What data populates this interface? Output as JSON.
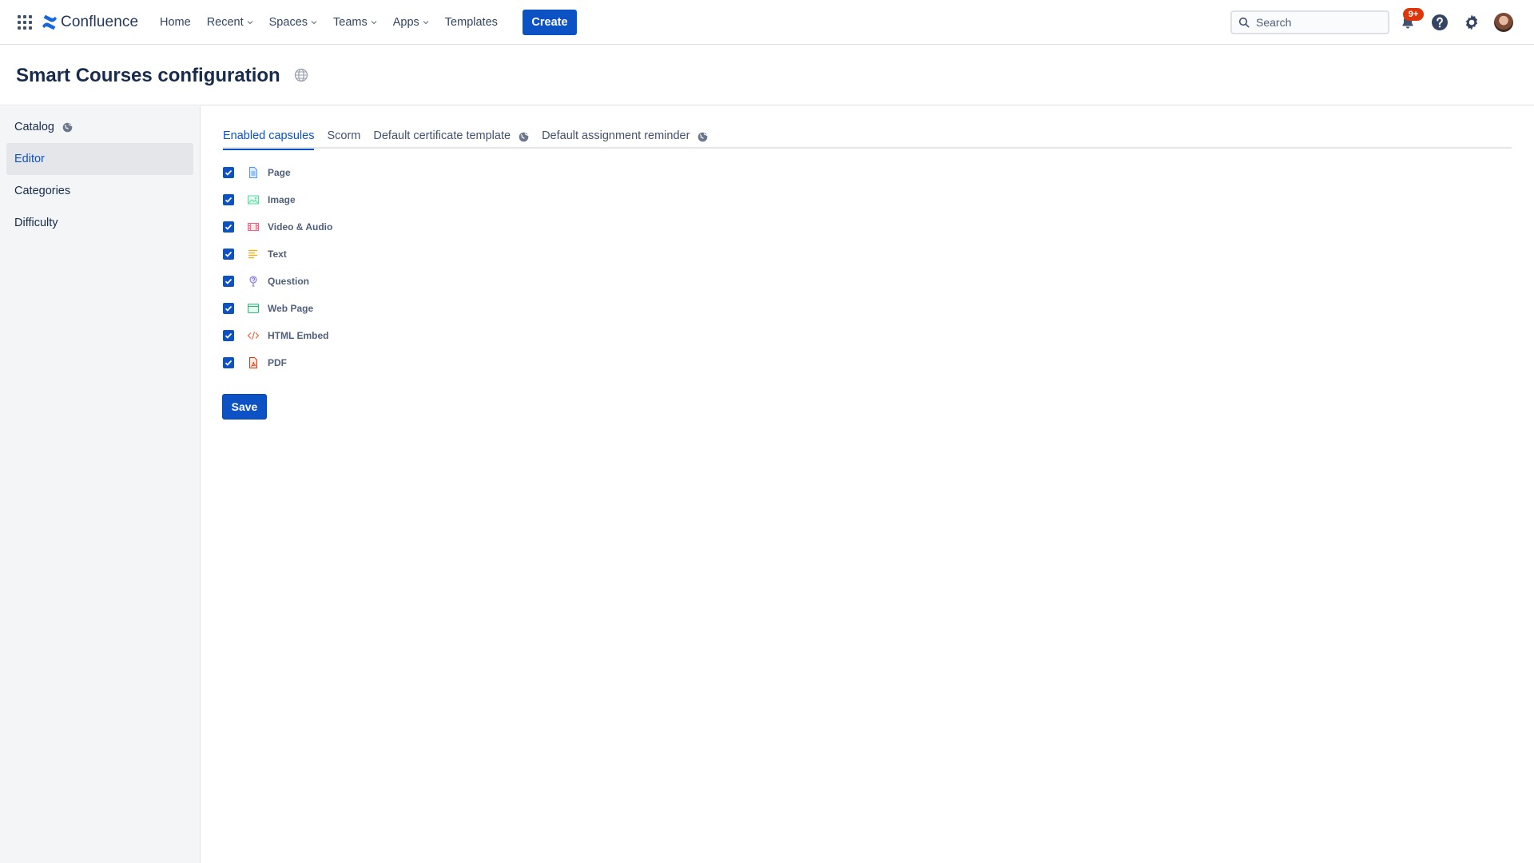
{
  "topnav": {
    "logo_text": "Confluence",
    "items": [
      {
        "label": "Home",
        "dropdown": false
      },
      {
        "label": "Recent",
        "dropdown": true
      },
      {
        "label": "Spaces",
        "dropdown": true
      },
      {
        "label": "Teams",
        "dropdown": true
      },
      {
        "label": "Apps",
        "dropdown": true
      },
      {
        "label": "Templates",
        "dropdown": false
      }
    ],
    "create_label": "Create",
    "search_placeholder": "Search",
    "notification_count": "9+",
    "icons": [
      "app-switcher-icon",
      "bell-icon",
      "help-icon",
      "settings-icon",
      "avatar"
    ]
  },
  "page": {
    "title": "Smart Courses configuration"
  },
  "sidebar": {
    "items": [
      {
        "label": "Catalog",
        "globe": true,
        "active": false
      },
      {
        "label": "Editor",
        "globe": false,
        "active": true
      },
      {
        "label": "Categories",
        "globe": false,
        "active": false
      },
      {
        "label": "Difficulty",
        "globe": false,
        "active": false
      }
    ]
  },
  "tabs": [
    {
      "label": "Enabled capsules",
      "globe": false,
      "active": true
    },
    {
      "label": "Scorm",
      "globe": false,
      "active": false
    },
    {
      "label": "Default certificate template",
      "globe": true,
      "active": false
    },
    {
      "label": "Default assignment reminder",
      "globe": true,
      "active": false
    }
  ],
  "capsules": [
    {
      "label": "Page",
      "checked": true,
      "icon": "page-icon",
      "color": "#4c9aff"
    },
    {
      "label": "Image",
      "checked": true,
      "icon": "image-icon",
      "color": "#57d9a3"
    },
    {
      "label": "Video & Audio",
      "checked": true,
      "icon": "video-icon",
      "color": "#ff5c8a"
    },
    {
      "label": "Text",
      "checked": true,
      "icon": "text-icon",
      "color": "#ffab00"
    },
    {
      "label": "Question",
      "checked": true,
      "icon": "question-icon",
      "color": "#8777d9"
    },
    {
      "label": "Web Page",
      "checked": true,
      "icon": "web-page-icon",
      "color": "#36b37e"
    },
    {
      "label": "HTML Embed",
      "checked": true,
      "icon": "code-icon",
      "color": "#ff5630"
    },
    {
      "label": "PDF",
      "checked": true,
      "icon": "pdf-icon",
      "color": "#de350b"
    }
  ],
  "save_label": "Save",
  "colors": {
    "primary": "#0c52c5",
    "text": "#172b4d",
    "sidebar_bg": "#f4f5f7",
    "badge": "#de350b"
  }
}
